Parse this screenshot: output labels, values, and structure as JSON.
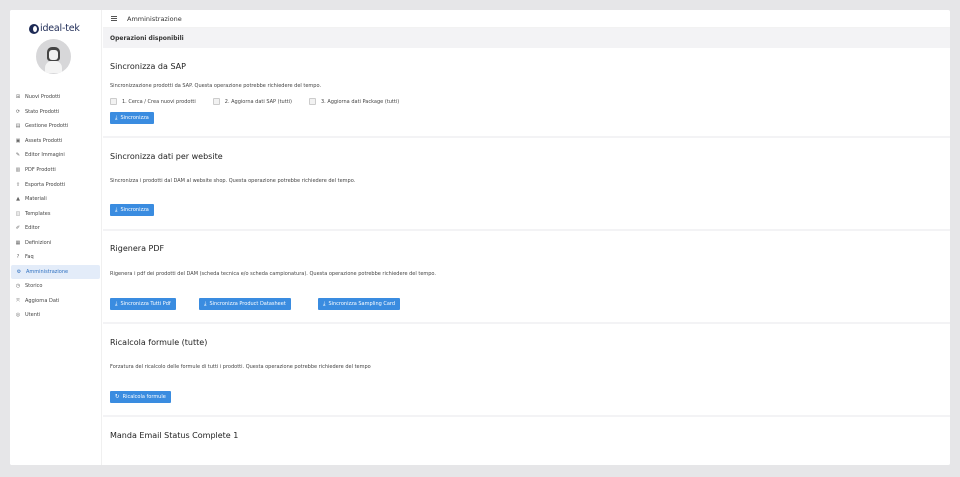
{
  "brand": {
    "logo_text": "ideal-tek"
  },
  "sidebar": {
    "items": [
      {
        "label": "Nuovi Prodotti",
        "icon": "grid-icon",
        "glyph": "⊞"
      },
      {
        "label": "Stato Prodotti",
        "icon": "sync-icon",
        "glyph": "⟳"
      },
      {
        "label": "Gestione Prodotti",
        "icon": "document-icon",
        "glyph": "▤"
      },
      {
        "label": "Assets Prodotti",
        "icon": "image-icon",
        "glyph": "▣"
      },
      {
        "label": "Editor Immagini",
        "icon": "brush-icon",
        "glyph": "✎"
      },
      {
        "label": "PDF Prodotti",
        "icon": "pdf-icon",
        "glyph": "▥"
      },
      {
        "label": "Esporta Prodotti",
        "icon": "export-icon",
        "glyph": "⇪"
      },
      {
        "label": "Materiali",
        "icon": "layers-icon",
        "glyph": "▲"
      },
      {
        "label": "Templates",
        "icon": "template-icon",
        "glyph": "◫"
      },
      {
        "label": "Editor",
        "icon": "edit-icon",
        "glyph": "✐"
      },
      {
        "label": "Definizioni",
        "icon": "calendar-icon",
        "glyph": "▦"
      },
      {
        "label": "Faq",
        "icon": "help-icon",
        "glyph": "?"
      },
      {
        "label": "Amministrazione",
        "icon": "settings-icon",
        "glyph": "⚙",
        "active": true
      },
      {
        "label": "Storico",
        "icon": "history-icon",
        "glyph": "◷"
      },
      {
        "label": "Aggiorna Dati",
        "icon": "update-icon",
        "glyph": "⤧"
      },
      {
        "label": "Utenti",
        "icon": "users-icon",
        "glyph": "◎"
      }
    ]
  },
  "topbar": {
    "title": "Amministrazione"
  },
  "main": {
    "subhead": "Operazioni disponibili",
    "sap": {
      "title": "Sincronizza da SAP",
      "desc": "Sincronizzazione prodotti da SAP. Questa operazione potrebbe richiedere del tempo.",
      "options": [
        "1. Cerca / Crea nuovi prodotti",
        "2. Aggiorna dati SAP (tutti)",
        "3. Aggiorna dati Package (tutti)"
      ],
      "button": "Sincronizza"
    },
    "website": {
      "title": "Sincronizza dati per website",
      "desc": "Sincronizza i prodotti dal DAM al website shop. Questa operazione potrebbe richiedere del tempo.",
      "button": "Sincronizza"
    },
    "pdf": {
      "title": "Rigenera PDF",
      "desc": "Rigenera i pdf dei prodotti del DAM (scheda tecnica e/o scheda campionatura). Questa operazione potrebbe richiedere del tempo.",
      "buttons": [
        "Sincronizza Tutti Pdf",
        "Sincronizza Product Datasheet",
        "Sincronizza Sampling Card"
      ]
    },
    "formule": {
      "title": "Ricalcola formule (tutte)",
      "desc": "Forzatura del ricalcolo delle formule di tutti i prodotti. Questa operazione potrebbe richiedere del tempo",
      "button": "Ricalcola formule"
    },
    "email": {
      "title": "Manda Email Status Complete 1"
    }
  },
  "colors": {
    "accent": "#3a8ce0",
    "active_bg": "#e3ecf9",
    "brand": "#1d2a55"
  }
}
